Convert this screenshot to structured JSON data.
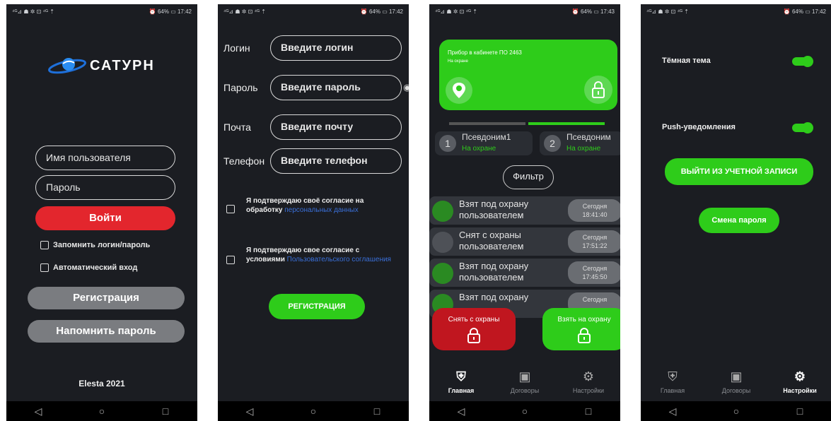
{
  "status": {
    "left": "⁴ᴳ⊿ ☗ ✲ ⊡ ⁴ᴳ ⇡",
    "right": "⏰ 64% ▭ 17:42",
    "right_b": "⏰ 64% ▭ 17:43"
  },
  "nav": {
    "back": "◁",
    "home": "○",
    "recent": "□"
  },
  "login": {
    "brand": "САТУРН",
    "username_placeholder": "Имя пользователя",
    "password_placeholder": "Пароль",
    "login_button": "Войти",
    "remember": "Запомнить логин/пароль",
    "auto_login": "Автоматический вход",
    "register_button": "Регистрация",
    "reminder_button": "Напомнить пароль",
    "footer": "Elesta 2021"
  },
  "register": {
    "fields": [
      {
        "label": "Логин",
        "placeholder": "Введите логин"
      },
      {
        "label": "Пароль",
        "placeholder": "Введите пароль"
      },
      {
        "label": "Почта",
        "placeholder": "Введите почту"
      },
      {
        "label": "Телефон",
        "placeholder": "Введите телефон"
      }
    ],
    "consent1_text": "Я подтверждаю своё согласие на обработку ",
    "consent1_link": "персональных данных",
    "consent2_text": "Я подтверждаю свое согласие с условиями ",
    "consent2_link": "Пользовательского соглашения",
    "submit": "РЕГИСТРАЦИЯ",
    "eye_icon": "◉"
  },
  "main": {
    "device_title": "Прибор в кабинете ПО 2463",
    "device_status": "На охране",
    "chips": [
      {
        "num": "1",
        "name": "Псевдоним1",
        "status": "На охране"
      },
      {
        "num": "2",
        "name": "Псевдоним",
        "status": "На охране"
      }
    ],
    "filter": "Фильтр",
    "events": [
      {
        "line1": "Взят под охрану",
        "line2": "пользователем",
        "day": "Сегодня",
        "time": "18:41:40",
        "armed": true
      },
      {
        "line1": "Снят с охраны",
        "line2": "пользователем",
        "day": "Сегодня",
        "time": "17:51:22",
        "armed": false
      },
      {
        "line1": "Взят под охрану",
        "line2": "пользователем",
        "day": "Сегодня",
        "time": "17:45:50",
        "armed": true
      },
      {
        "line1": "Взят под охрану",
        "line2": "",
        "day": "Сегодня",
        "time": "",
        "armed": true
      }
    ],
    "disarm_button": "Снять с охраны",
    "arm_button": "Взять на охрану",
    "tabs": [
      "Главная",
      "Договоры",
      "Настройки"
    ]
  },
  "settings": {
    "dark_theme": "Тёмная тема",
    "push": "Push-уведомления",
    "logout": "ВЫЙТИ ИЗ УЧЕТНОЙ ЗАПИСИ",
    "change_password": "Смена пароля",
    "tabs": [
      "Главная",
      "Договоры",
      "Настройки"
    ]
  },
  "colors": {
    "green": "#2ecc1a",
    "red": "#e3262d",
    "dark_red": "#c0161f",
    "bg": "#1b1d22"
  }
}
